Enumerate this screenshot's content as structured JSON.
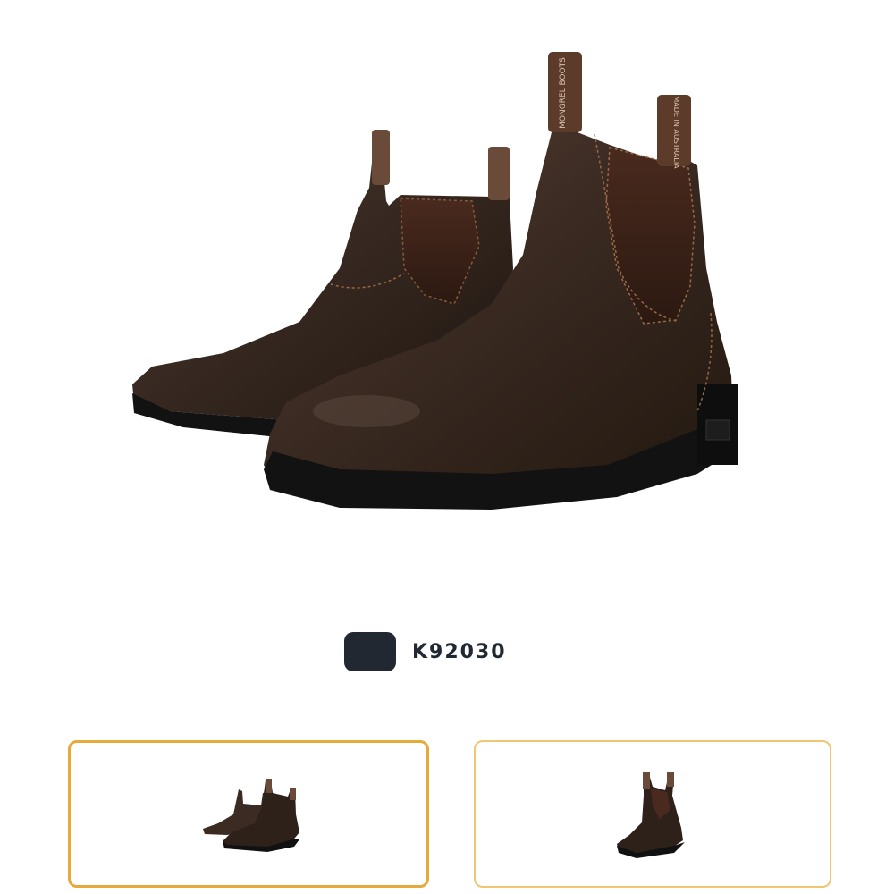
{
  "product": {
    "main_image": "brown-chelsea-boots-pair-image",
    "pull_tab_front": "MONGREL BOOTS",
    "pull_tab_back": "MADE IN AUSTRALIA"
  },
  "variant": {
    "code": "K92030",
    "swatch_color": "#222831"
  },
  "thumbnails": [
    {
      "image": "boots-pair-thumbnail",
      "selected": true,
      "border_color": "#e6a93a"
    },
    {
      "image": "single-boot-thumbnail",
      "selected": false,
      "border_color": "#efc672"
    }
  ]
}
